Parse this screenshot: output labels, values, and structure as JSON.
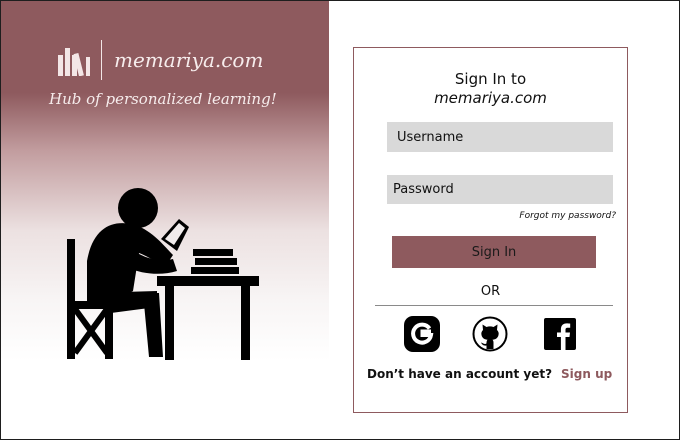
{
  "brand": {
    "name": "memariya.com",
    "tagline": "Hub of personalized learning!"
  },
  "signin": {
    "title": "Sign In to",
    "brand": "memariya.com",
    "username_placeholder": "Username",
    "password_placeholder": "Password",
    "forgot_password": "Forgot my password?",
    "signin_button": "Sign In",
    "or": "OR",
    "no_account": "Don’t have an account yet?",
    "signup": "Sign up"
  },
  "social": [
    "google-icon",
    "github-icon",
    "facebook-icon"
  ],
  "colors": {
    "accent": "#8e5a5e",
    "field_bg": "#d9d9d9"
  }
}
